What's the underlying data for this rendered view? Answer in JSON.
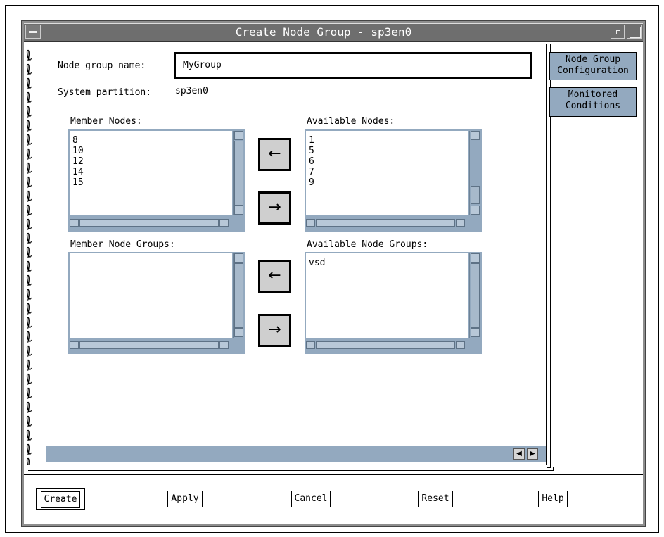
{
  "window": {
    "title": "Create Node Group - sp3en0"
  },
  "form": {
    "name_label": "Node group name:",
    "name_value": "MyGroup",
    "partition_label": "System partition:",
    "partition_value": "sp3en0"
  },
  "member_nodes": {
    "label": "Member Nodes:",
    "items": [
      "8",
      "10",
      "12",
      "14",
      "15"
    ]
  },
  "available_nodes": {
    "label": "Available Nodes:",
    "items": [
      "1",
      "5",
      "6",
      "7",
      "9"
    ]
  },
  "member_groups": {
    "label": "Member Node Groups:",
    "items": []
  },
  "available_groups": {
    "label": "Available Node Groups:",
    "items": [
      "vsd"
    ]
  },
  "move_buttons": {
    "left": "←",
    "right": "→"
  },
  "tabs": {
    "node_group_config": [
      "Node Group",
      "Configuration"
    ],
    "monitored": [
      "Monitored",
      "Conditions"
    ]
  },
  "page_nav": {
    "prev": "◀",
    "next": "▶"
  },
  "buttons": {
    "create": "Create",
    "apply": "Apply",
    "cancel": "Cancel",
    "reset": "Reset",
    "help": "Help"
  },
  "colors": {
    "list_frame": "#93a9bf",
    "titlebar": "#6e6e6e"
  }
}
